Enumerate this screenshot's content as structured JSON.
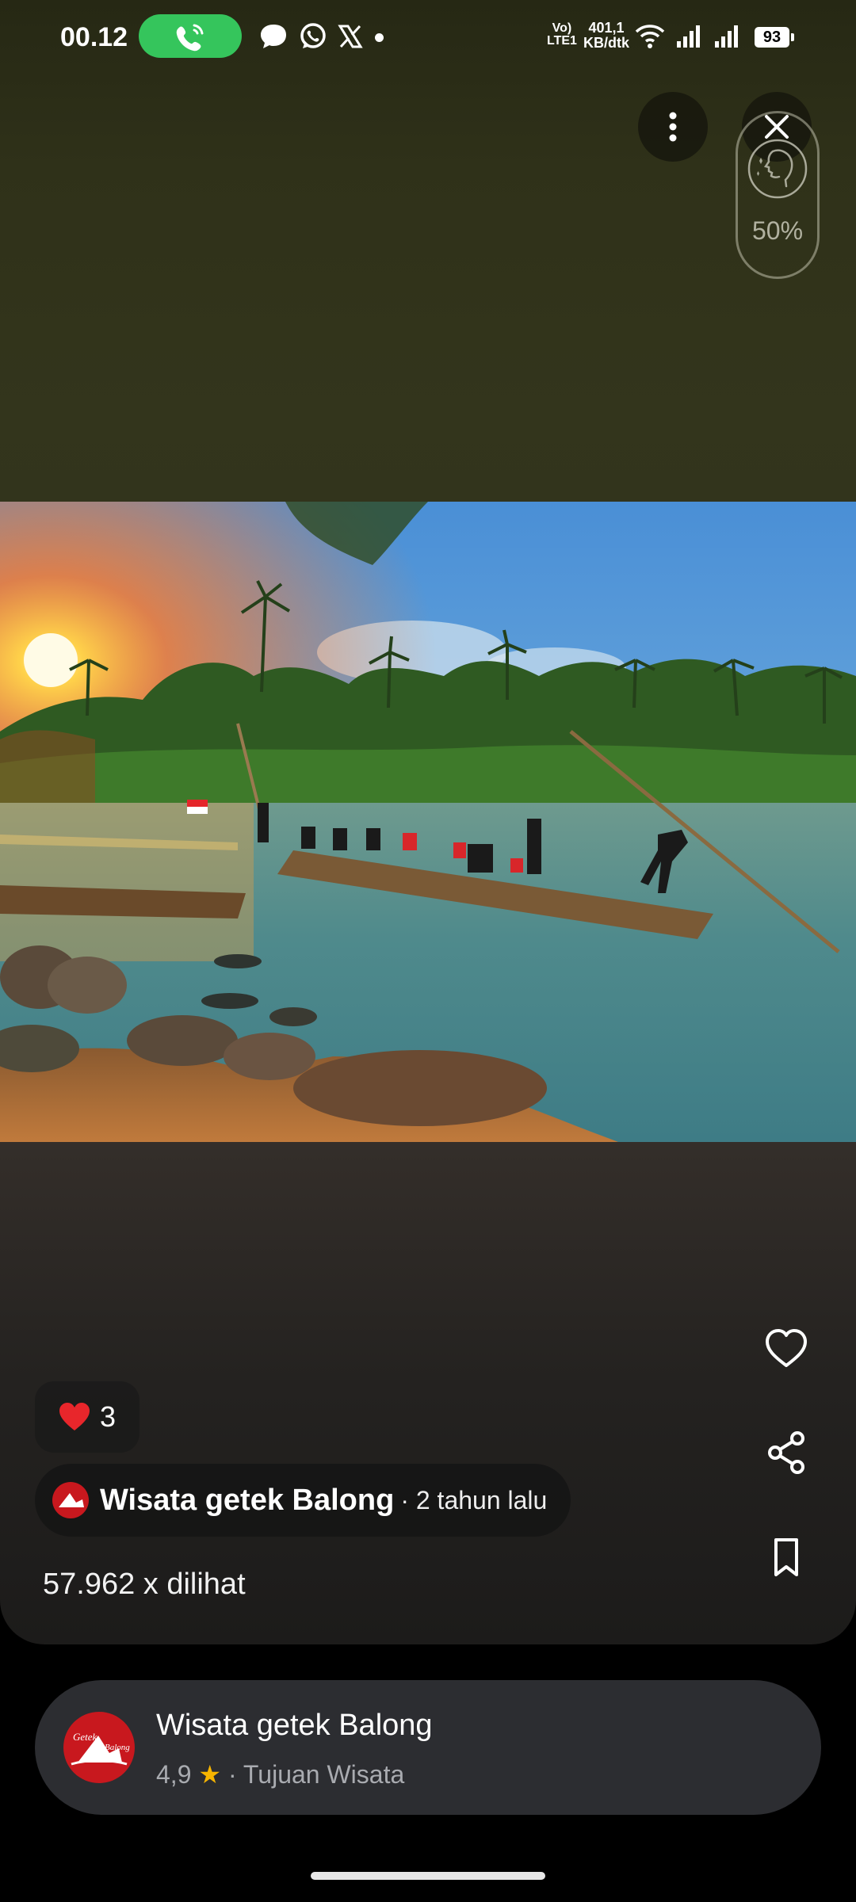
{
  "status_bar": {
    "time": "00.12",
    "network_label_top": "Vo)",
    "network_label_bottom": "LTE1",
    "speed_value": "401,1",
    "speed_unit": "KB/dtk",
    "battery": "93"
  },
  "face_filter": {
    "percent": "50%"
  },
  "post": {
    "likes_count": "3",
    "author_name": "Wisata getek Balong",
    "posted_time": "· 2 tahun lalu",
    "views": "57.962 x dilihat"
  },
  "place": {
    "name": "Wisata getek Balong",
    "rating": "4,9",
    "category": "· Tujuan Wisata",
    "logo_text_top": "Getek",
    "logo_text_right": "Balong"
  },
  "colors": {
    "call_pill": "#35c55c",
    "brand_red": "#c8181e",
    "star": "#f7b500",
    "card_bg": "#2c2d31"
  }
}
